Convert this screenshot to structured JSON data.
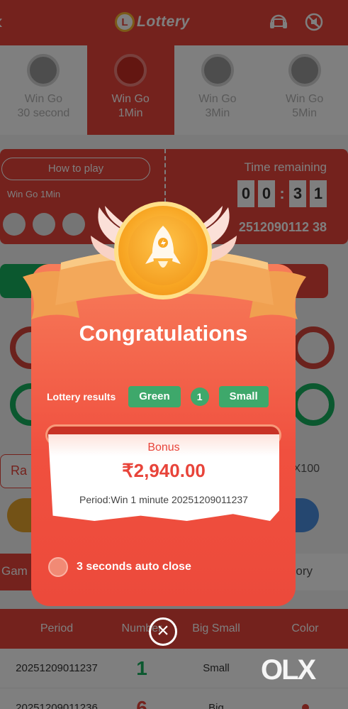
{
  "header": {
    "back_icon": "chevron-left-icon",
    "logo_badge": "L",
    "logo_text": "Lottery",
    "icons": [
      "headset-icon",
      "sound-off-icon"
    ]
  },
  "games": [
    {
      "name_line1": "Win Go",
      "name_line2": "30 second",
      "active": false
    },
    {
      "name_line1": "Win Go",
      "name_line2": "1Min",
      "active": true
    },
    {
      "name_line1": "Win Go",
      "name_line2": "3Min",
      "active": false
    },
    {
      "name_line1": "Win Go",
      "name_line2": "5Min",
      "active": false
    }
  ],
  "timer": {
    "how_to_play": "How to play",
    "sub_label": "Win Go 1Min",
    "time_label": "Time remaining",
    "digits": [
      "0",
      "0",
      ":",
      "3",
      "1"
    ],
    "period": "2512090112 38"
  },
  "controls": {
    "random": "Ra",
    "multiplier": "X100"
  },
  "tabs": {
    "game_history": "Gam",
    "history": "ory"
  },
  "table": {
    "headers": [
      "Period",
      "Number",
      "Big Small",
      "Color"
    ],
    "rows": [
      {
        "period": "20251209011237",
        "number": "1",
        "size": "Small"
      },
      {
        "period": "20251209011236",
        "number": "6",
        "size": "Big"
      }
    ]
  },
  "modal": {
    "title": "Congratulations",
    "results_label": "Lottery results",
    "result_color": "Green",
    "result_number": "1",
    "result_size": "Small",
    "bonus_label": "Bonus",
    "bonus_amount": "₹2,940.00",
    "period_text": "Period:Win 1 minute 20251209011237",
    "auto_close": "3 seconds auto close"
  },
  "watermark": "OLX",
  "colors": {
    "primary_red": "#e8443a",
    "green": "#17b15e",
    "gold": "#f8a623"
  }
}
